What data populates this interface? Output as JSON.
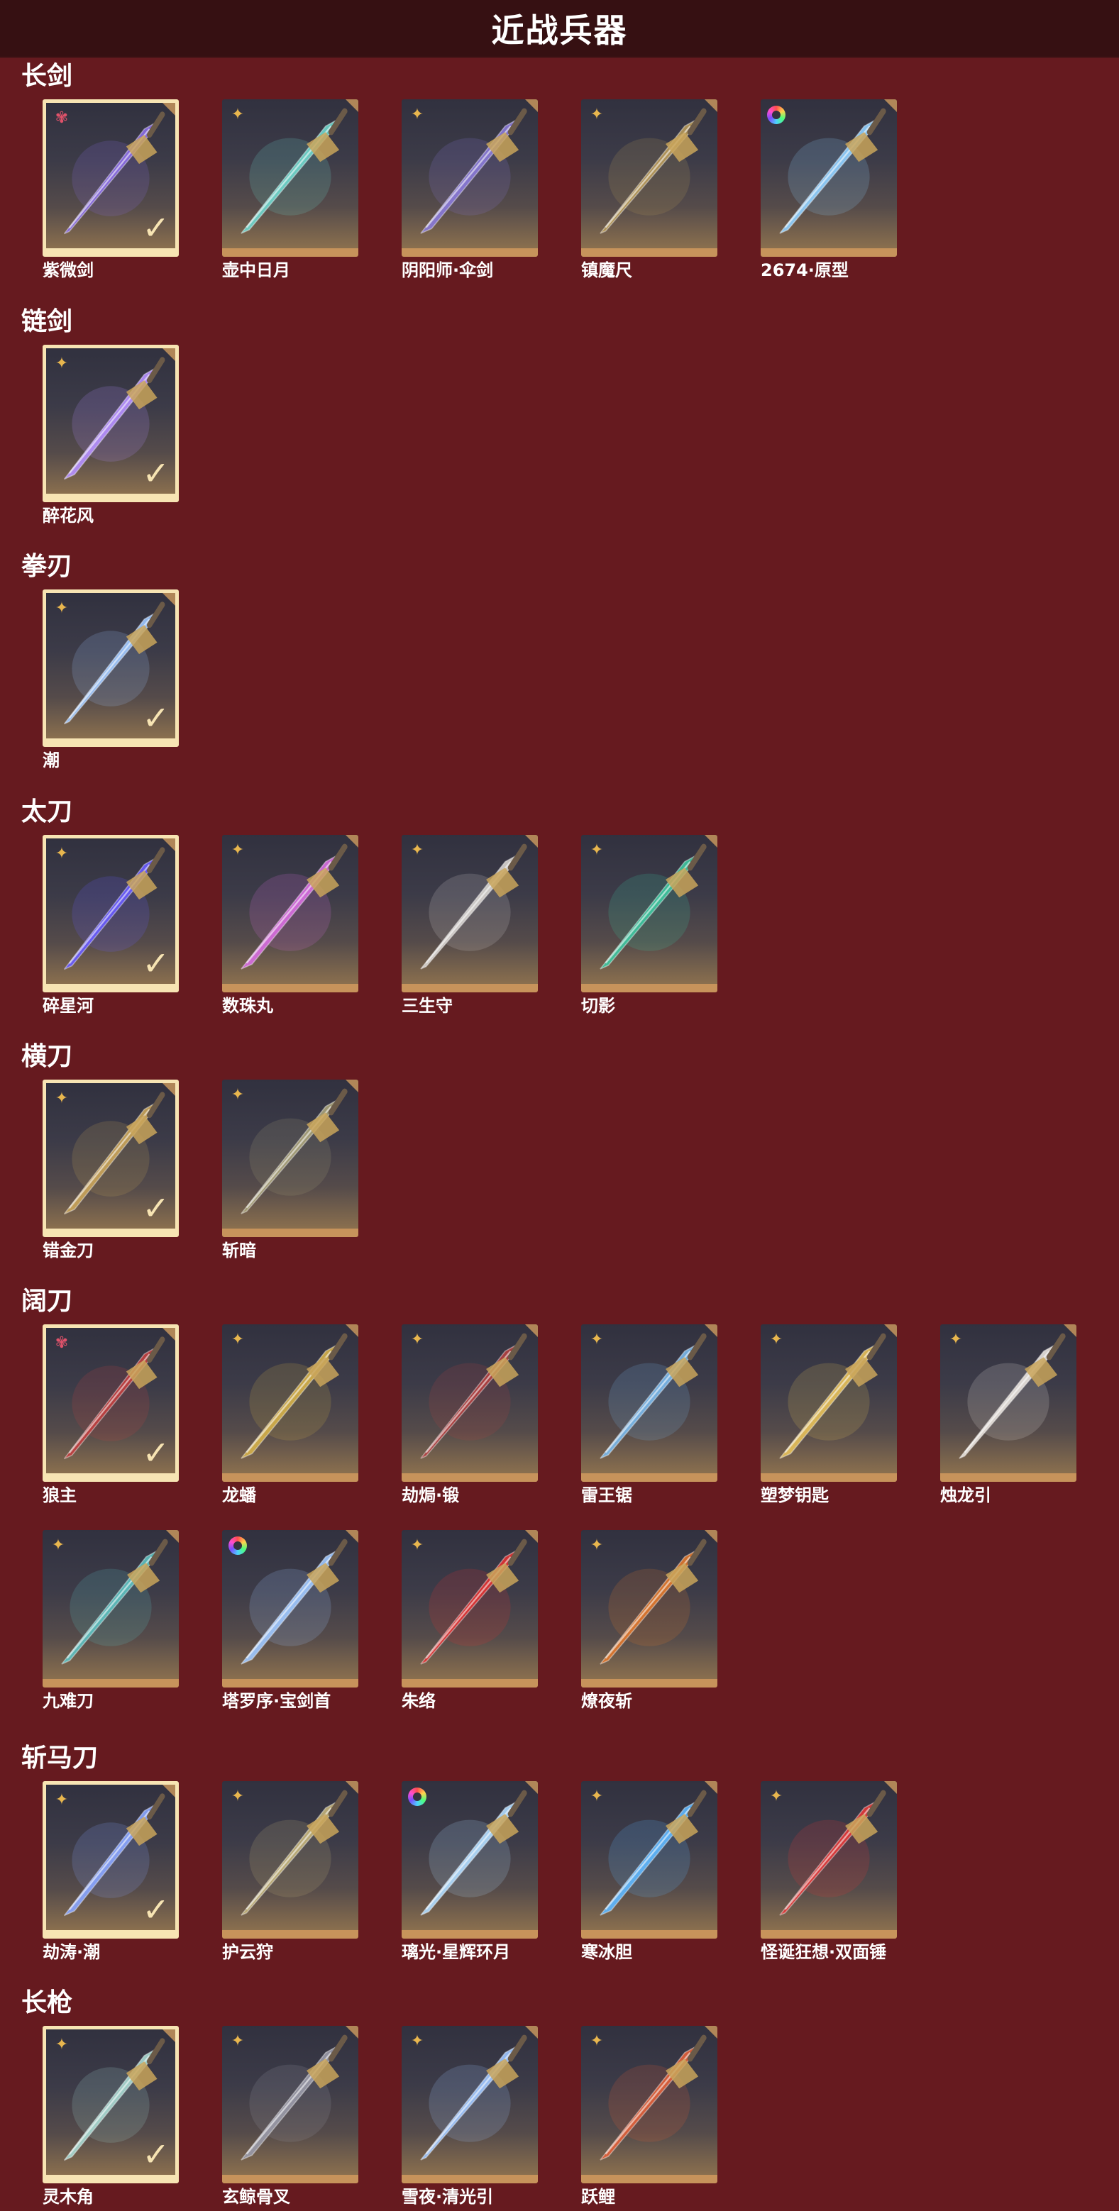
{
  "title": "近战兵器",
  "colors": {
    "background": "#661a1f",
    "title_bar": "#361012",
    "card_owned_border": "#f7e4b3",
    "card_bottom": "#c7935b",
    "rarity_gold": "#e8b64e",
    "rarity_red": "#e0526a"
  },
  "sections": [
    {
      "label": "长剑",
      "items": [
        {
          "name": "紫微剑",
          "owned": true,
          "rarity": "red-star-icon",
          "accent": "#8c6ee6"
        },
        {
          "name": "壶中日月",
          "owned": false,
          "rarity": "gold-star-icon",
          "accent": "#6fd6cc"
        },
        {
          "name": "阴阳师·伞剑",
          "owned": false,
          "rarity": "gold-star-icon",
          "accent": "#8a7ad8"
        },
        {
          "name": "镇魔尺",
          "owned": false,
          "rarity": "gold-star-icon",
          "accent": "#b79a5a"
        },
        {
          "name": "2674·原型",
          "owned": false,
          "rarity": "rainbow-ring-icon",
          "accent": "#8fd0ff"
        }
      ]
    },
    {
      "label": "链剑",
      "items": [
        {
          "name": "醉花风",
          "owned": true,
          "rarity": "gold-star-icon",
          "accent": "#b690ff"
        }
      ]
    },
    {
      "label": "拳刃",
      "items": [
        {
          "name": "潮",
          "owned": true,
          "rarity": "gold-star-icon",
          "accent": "#9fc8ff"
        }
      ]
    },
    {
      "label": "太刀",
      "items": [
        {
          "name": "碎星河",
          "owned": true,
          "rarity": "gold-star-icon",
          "accent": "#6a5cff"
        },
        {
          "name": "数珠丸",
          "owned": false,
          "rarity": "gold-star-icon",
          "accent": "#d86ee0"
        },
        {
          "name": "三生守",
          "owned": false,
          "rarity": "gold-star-icon",
          "accent": "#d8d4d0"
        },
        {
          "name": "切影",
          "owned": false,
          "rarity": "gold-star-icon",
          "accent": "#3fc6a0"
        }
      ]
    },
    {
      "label": "横刀",
      "items": [
        {
          "name": "错金刀",
          "owned": true,
          "rarity": "gold-star-icon",
          "accent": "#c9a45a"
        },
        {
          "name": "斩暗",
          "owned": false,
          "rarity": "gold-star-icon",
          "accent": "#a9a27a"
        }
      ]
    },
    {
      "label": "阔刀",
      "items": [
        {
          "name": "狼主",
          "owned": true,
          "rarity": "red-star-icon",
          "accent": "#c04040"
        },
        {
          "name": "龙蟠",
          "owned": false,
          "rarity": "gold-star-icon",
          "accent": "#d4b04a"
        },
        {
          "name": "劫焗·锻",
          "owned": false,
          "rarity": "gold-star-icon",
          "accent": "#b04040"
        },
        {
          "name": "雷王锯",
          "owned": false,
          "rarity": "gold-star-icon",
          "accent": "#7ab8ea"
        },
        {
          "name": "塑梦钥匙",
          "owned": false,
          "rarity": "gold-star-icon",
          "accent": "#e6c05a"
        },
        {
          "name": "烛龙引",
          "owned": false,
          "rarity": "gold-star-icon",
          "accent": "#e8e2dc"
        },
        {
          "name": "九难刀",
          "owned": false,
          "rarity": "gold-star-icon",
          "accent": "#5ec0c0"
        },
        {
          "name": "塔罗序·宝剑首",
          "owned": false,
          "rarity": "rainbow-ring-icon",
          "accent": "#9fc8ff"
        },
        {
          "name": "朱络",
          "owned": false,
          "rarity": "gold-star-icon",
          "accent": "#e03434"
        },
        {
          "name": "燎夜斩",
          "owned": false,
          "rarity": "gold-star-icon",
          "accent": "#e0782e"
        }
      ]
    },
    {
      "label": "斩马刀",
      "items": [
        {
          "name": "劫涛·潮",
          "owned": true,
          "rarity": "gold-star-icon",
          "accent": "#8aa6ff"
        },
        {
          "name": "护云狩",
          "owned": false,
          "rarity": "gold-star-icon",
          "accent": "#c2b27a"
        },
        {
          "name": "璃光·星辉环月",
          "owned": false,
          "rarity": "rainbow-ring-icon",
          "accent": "#b0dcff"
        },
        {
          "name": "寒冰胆",
          "owned": false,
          "rarity": "gold-star-icon",
          "accent": "#5fb8ff"
        },
        {
          "name": "怪诞狂想·双面锤",
          "owned": false,
          "rarity": "gold-star-icon",
          "accent": "#e23a3a"
        }
      ]
    },
    {
      "label": "长枪",
      "items": [
        {
          "name": "灵木角",
          "owned": true,
          "rarity": "gold-star-icon",
          "accent": "#a8d8d0"
        },
        {
          "name": "玄鲸骨叉",
          "owned": false,
          "rarity": "gold-star-icon",
          "accent": "#9a9aa8"
        },
        {
          "name": "雪夜·清光引",
          "owned": false,
          "rarity": "gold-star-icon",
          "accent": "#9ec6ff"
        },
        {
          "name": "跃鲤",
          "owned": false,
          "rarity": "gold-star-icon",
          "accent": "#e0603a"
        }
      ]
    }
  ]
}
